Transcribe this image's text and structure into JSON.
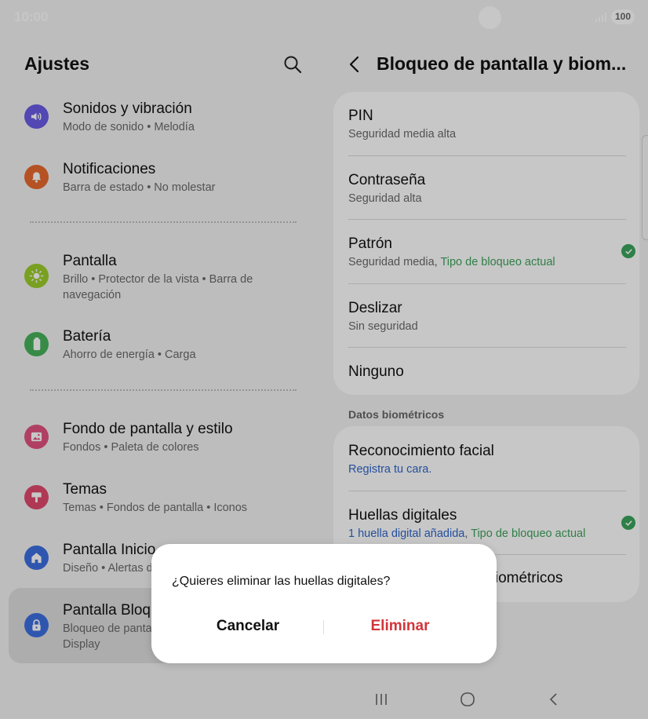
{
  "status_bar": {
    "time": "10:00",
    "battery": "100"
  },
  "left_panel": {
    "title": "Ajustes",
    "items": [
      {
        "title": "Sonidos y vibración",
        "subtitle": "Modo de sonido • Melodía",
        "icon": "volume-icon",
        "color": "#6a5ce6"
      },
      {
        "title": "Notificaciones",
        "subtitle": "Barra de estado • No molestar",
        "icon": "bell-icon",
        "color": "#e86a2e"
      },
      {
        "title": "Pantalla",
        "subtitle": "Brillo • Protector de la vista • Barra de navegación",
        "icon": "sun-icon",
        "color": "#9ccd2a"
      },
      {
        "title": "Batería",
        "subtitle": "Ahorro de energía • Carga",
        "icon": "battery-icon",
        "color": "#47b35a"
      },
      {
        "title": "Fondo de pantalla y estilo",
        "subtitle": "Fondos • Paleta de colores",
        "icon": "image-icon",
        "color": "#e2527f"
      },
      {
        "title": "Temas",
        "subtitle": "Temas • Fondos de pantalla • Iconos",
        "icon": "brush-icon",
        "color": "#e04a6e"
      },
      {
        "title": "Pantalla Inicio",
        "subtitle": "Diseño • Alertas d",
        "icon": "home-icon",
        "color": "#3d6fe0"
      },
      {
        "title": "Pantalla Bloqu",
        "subtitle": "Bloqueo de panta\nDisplay",
        "icon": "lock-icon",
        "color": "#3d6fe0"
      }
    ]
  },
  "right_panel": {
    "title": "Bloqueo de pantalla y biom...",
    "lock_options": [
      {
        "title": "PIN",
        "subtitle": "Seguridad media alta"
      },
      {
        "title": "Contraseña",
        "subtitle": "Seguridad alta"
      },
      {
        "title": "Patrón",
        "subtitle": "Seguridad media, ",
        "subtitle_highlight": "Tipo de bloqueo actual"
      },
      {
        "title": "Deslizar",
        "subtitle": "Sin seguridad"
      },
      {
        "title": "Ninguno"
      }
    ],
    "section_label": "Datos biométricos",
    "biometric_options": [
      {
        "title": "Reconocimiento facial",
        "subtitle_link": "Registra tu cara."
      },
      {
        "title": "Huellas digitales",
        "subtitle_link": "1 huella digital añadida",
        "subtitle_rest": ", ",
        "subtitle_highlight": "Tipo de bloqueo actual"
      },
      {
        "title": "s biométricos"
      }
    ]
  },
  "dialog": {
    "message": "¿Quieres eliminar las huellas digitales?",
    "cancel_label": "Cancelar",
    "delete_label": "Eliminar"
  },
  "colors": {
    "accent_green": "#3ea35b",
    "link_blue": "#2f66c9",
    "destructive_red": "#d0353b"
  }
}
